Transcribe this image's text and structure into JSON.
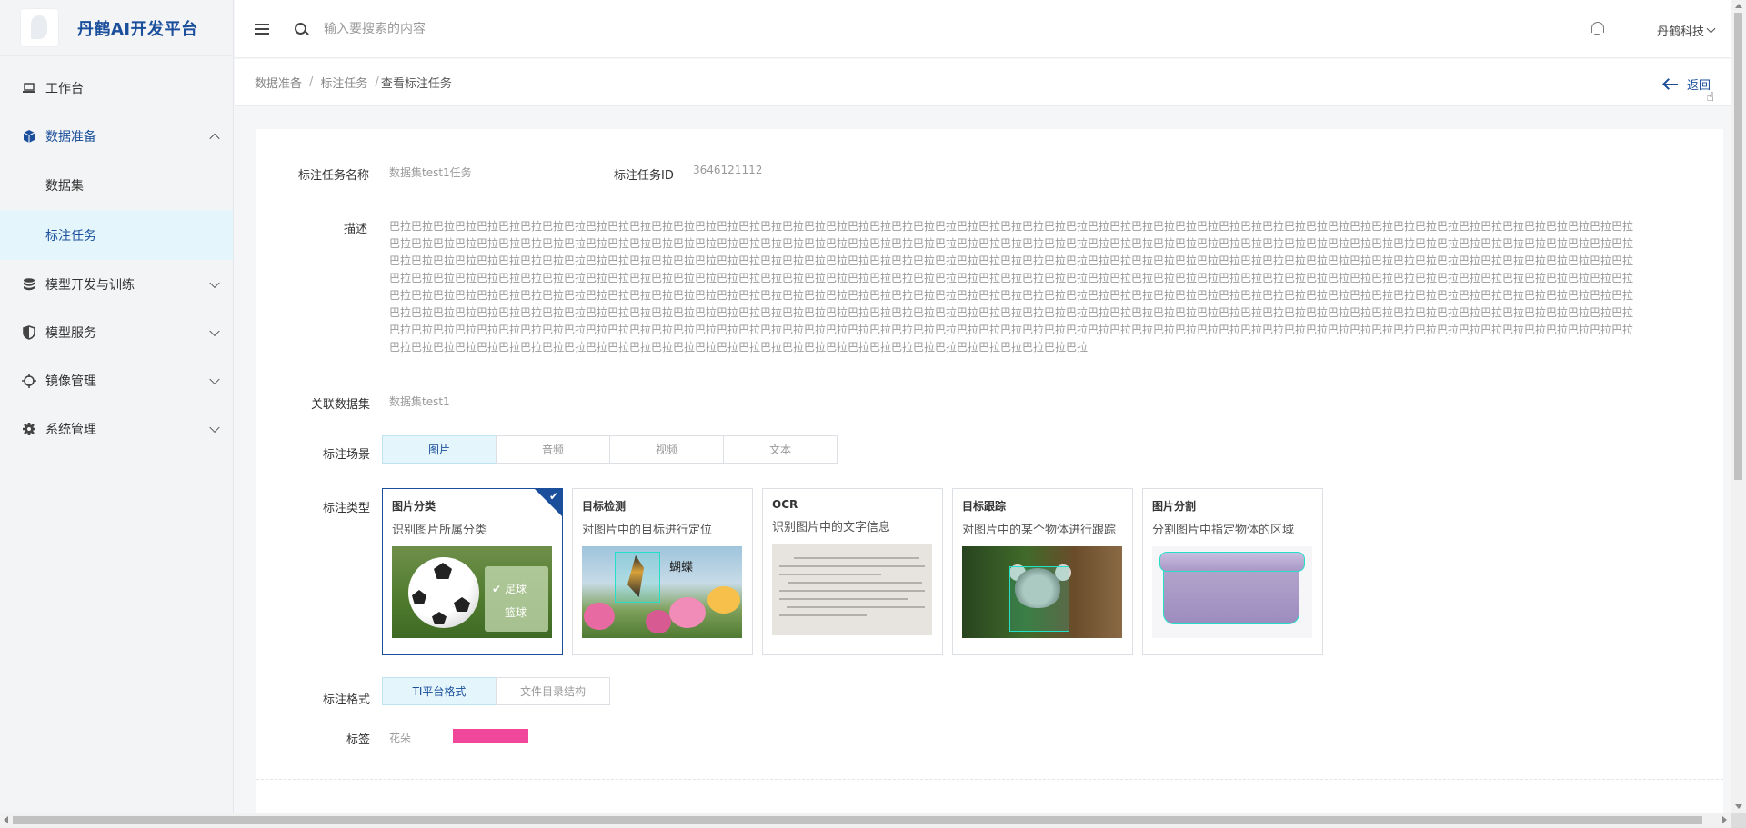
{
  "app": {
    "name": "丹鹤AI开发平台"
  },
  "sidebar": {
    "items": [
      {
        "label": "工作台",
        "icon": "laptop-icon"
      },
      {
        "label": "数据准备",
        "icon": "cube-icon",
        "expanded": true,
        "children": [
          {
            "label": "数据集"
          },
          {
            "label": "标注任务",
            "selected": true
          }
        ]
      },
      {
        "label": "模型开发与训练",
        "icon": "database-icon"
      },
      {
        "label": "模型服务",
        "icon": "shield-icon"
      },
      {
        "label": "镜像管理",
        "icon": "crosshair-icon"
      },
      {
        "label": "系统管理",
        "icon": "gear-icon"
      }
    ]
  },
  "header": {
    "search_placeholder": "输入要搜索的内容",
    "user": "丹鹤科技"
  },
  "breadcrumb": {
    "items": [
      "数据准备",
      "标注任务"
    ],
    "current": "查看标注任务",
    "back_label": "返回"
  },
  "form": {
    "task_name_label": "标注任务名称",
    "task_name_value": "数据集test1任务",
    "task_id_label": "标注任务ID",
    "task_id_value": "3646121112",
    "desc_label": "描述",
    "desc_value": "巴拉巴拉巴拉巴拉巴拉巴拉巴拉巴拉巴拉巴拉巴拉巴拉巴拉巴拉巴拉巴拉巴拉巴拉巴拉巴拉巴拉巴拉巴拉巴拉巴拉巴拉巴拉巴拉巴拉巴拉巴拉巴拉巴拉巴拉巴拉巴拉巴拉巴拉巴拉巴拉巴拉巴拉巴拉巴拉巴拉巴拉巴拉巴拉巴拉巴拉巴拉巴拉巴拉巴拉巴拉巴拉巴拉巴拉巴拉巴拉巴拉巴拉巴拉巴拉巴拉巴拉巴拉巴拉巴拉巴拉巴拉巴拉巴拉巴拉巴拉巴拉巴拉巴拉巴拉巴拉巴拉巴拉巴拉巴拉巴拉巴拉巴拉巴拉巴拉巴拉巴拉巴拉巴拉巴拉巴拉巴拉巴拉巴拉巴拉巴拉巴拉巴拉巴拉巴拉巴拉巴拉巴拉巴拉巴拉巴拉巴拉巴拉巴拉巴拉巴拉巴拉巴拉巴拉巴拉巴拉巴拉巴拉巴拉巴拉巴拉巴拉巴拉巴拉巴拉巴拉巴拉巴拉巴拉巴拉巴拉巴拉巴拉巴拉巴拉巴拉巴拉巴拉巴拉巴拉巴拉巴拉巴拉巴拉巴拉巴拉巴拉巴拉巴拉巴拉巴拉巴拉巴拉巴拉巴拉巴拉巴拉巴拉巴拉巴拉巴拉巴拉巴拉巴拉巴拉巴拉巴拉巴拉巴拉巴拉巴拉巴拉巴拉巴拉巴拉巴拉巴拉巴拉巴拉巴拉巴拉巴拉巴拉巴拉巴拉巴拉巴拉巴拉巴拉巴拉巴拉巴拉巴拉巴拉巴拉巴拉巴拉巴拉巴拉巴拉巴拉巴拉巴拉巴拉巴拉巴拉巴拉巴拉巴拉巴拉巴拉巴拉巴拉巴拉巴拉巴拉巴拉巴拉巴拉巴拉巴拉巴拉巴拉巴拉巴拉巴拉巴拉巴拉巴拉巴拉巴拉巴拉巴拉巴拉巴拉巴拉巴拉巴拉巴拉巴拉巴拉巴拉巴拉巴拉巴拉巴拉巴拉巴拉巴拉巴拉巴拉巴拉巴拉巴拉巴拉巴拉巴拉巴拉巴拉巴拉巴拉巴拉巴拉巴拉巴拉巴拉巴拉巴拉巴拉巴拉巴拉巴拉巴拉巴拉巴拉巴拉巴拉巴拉巴拉巴拉巴拉巴拉巴拉巴拉巴拉巴拉巴拉巴拉巴拉巴拉巴拉巴拉巴拉巴拉巴拉巴拉巴拉巴拉巴拉巴拉巴拉巴拉巴拉巴拉巴拉巴拉巴拉巴拉巴拉巴拉巴拉巴拉巴拉巴拉巴拉巴拉巴拉巴拉巴拉巴拉巴拉巴拉巴拉巴拉巴拉巴拉巴拉巴拉巴拉巴拉巴拉巴拉巴拉巴拉巴拉巴拉巴拉巴拉巴拉巴拉巴拉巴拉巴拉巴拉巴拉巴拉巴拉巴拉巴拉巴拉巴拉巴拉巴拉巴拉巴拉巴拉巴拉巴拉巴拉巴拉巴拉巴拉巴拉巴拉巴拉巴拉巴拉巴拉巴拉巴拉巴拉巴拉巴拉巴拉巴拉巴拉巴拉巴拉巴拉巴拉巴拉巴拉巴拉巴拉巴拉巴拉巴拉巴拉巴拉巴拉巴拉巴拉巴拉巴拉巴拉巴拉巴拉巴拉巴拉巴拉巴拉巴拉巴拉巴拉巴拉巴拉巴拉巴拉巴拉巴拉巴拉巴拉巴拉巴拉巴拉巴拉巴拉巴拉巴拉巴拉巴拉巴拉巴拉巴拉巴拉巴拉巴拉",
    "dataset_label": "关联数据集",
    "dataset_value": "数据集test1",
    "scene_label": "标注场景",
    "scenes": [
      "图片",
      "音频",
      "视频",
      "文本"
    ],
    "scene_selected": "图片",
    "type_label": "标注类型",
    "types": [
      {
        "name": "图片分类",
        "desc": "识别图片所属分类",
        "selected": true,
        "labels": [
          "足球",
          "篮球"
        ]
      },
      {
        "name": "目标检测",
        "desc": "对图片中的目标进行定位",
        "labels": [
          "蝴蝶"
        ]
      },
      {
        "name": "OCR",
        "desc": "识别图片中的文字信息"
      },
      {
        "name": "目标跟踪",
        "desc": "对图片中的某个物体进行跟踪"
      },
      {
        "name": "图片分割",
        "desc": "分割图片中指定物体的区域"
      }
    ],
    "format_label": "标注格式",
    "formats": [
      "TI平台格式",
      "文件目录结构"
    ],
    "format_selected": "TI平台格式",
    "tag_label": "标签",
    "tag_value": "花朵",
    "tag_color": "#f0479a"
  },
  "colors": {
    "primary": "#1b4f9c",
    "selected_bg": "#e4f6fb",
    "box_outline": "#25e0c9"
  }
}
